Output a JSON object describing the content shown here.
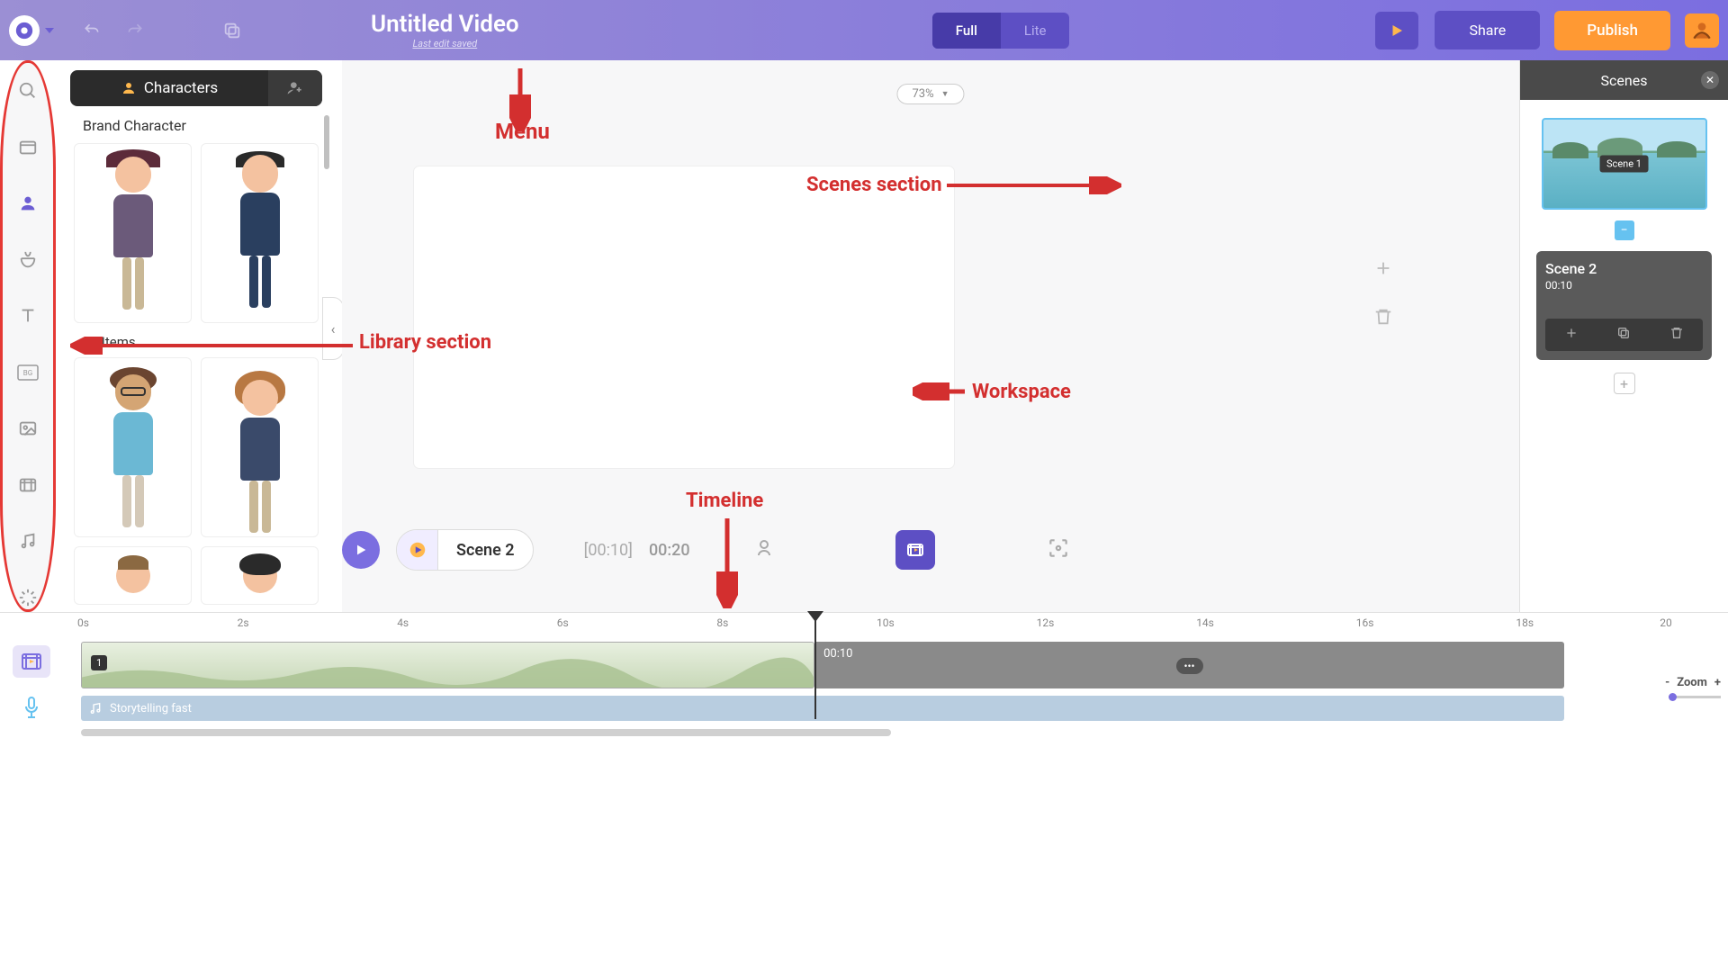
{
  "topbar": {
    "title": "Untitled Video",
    "subtitle": "Last edit saved",
    "mode_full": "Full",
    "mode_lite": "Lite",
    "share": "Share",
    "publish": "Publish"
  },
  "zoom_level": "73%",
  "library": {
    "tab_label": "Characters",
    "section1": "Brand Character",
    "section2": "All Items"
  },
  "scenes_panel": {
    "title": "Scenes",
    "scene1_badge": "Scene 1",
    "scene2_title": "Scene 2",
    "scene2_time": "00:10"
  },
  "tl_controls": {
    "scene_label": "Scene 2",
    "elapsed": "[00:10]",
    "duration": "00:20"
  },
  "timeline": {
    "ticks": [
      "0s",
      "2s",
      "4s",
      "6s",
      "8s",
      "10s",
      "12s",
      "14s",
      "16s",
      "18s",
      "20"
    ],
    "seg1_badge": "1",
    "seg2_time": "00:10",
    "audio_label": "Storytelling fast",
    "zoom_label": "Zoom",
    "zoom_minus": "-",
    "zoom_plus": "+"
  },
  "annotations": {
    "menu": "Menu",
    "library": "Library section",
    "scenes": "Scenes section",
    "workspace": "Workspace",
    "timeline": "Timeline"
  }
}
